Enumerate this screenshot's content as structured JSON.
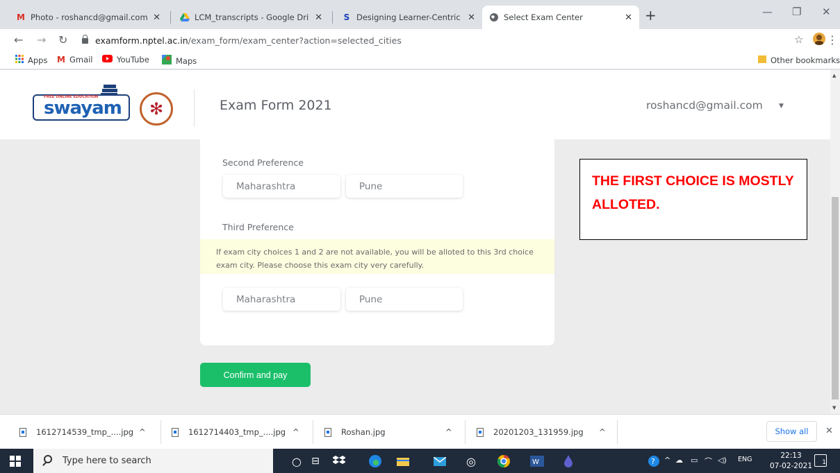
{
  "tabs": [
    {
      "title": "Photo - roshancd@gmail.com - G",
      "icon": "M"
    },
    {
      "title": "LCM_transcripts - Google Drive",
      "icon": "drive"
    },
    {
      "title": "Designing Learner-Centric MOOC",
      "icon": "S"
    },
    {
      "title": "Select Exam Center",
      "icon": "globe"
    }
  ],
  "toolbar": {
    "url_host": "examform.nptel.ac.in",
    "url_path": "/exam_form/exam_center?action=selected_cities"
  },
  "bookmarks": {
    "items": [
      "Apps",
      "Gmail",
      "YouTube",
      "Maps"
    ],
    "other": "Other bookmarks"
  },
  "header": {
    "logo_text": "swayam",
    "logo_small": "FREE ONLINE EDUCATION",
    "title": "Exam Form 2021",
    "user_email": "roshancd@gmail.com"
  },
  "form": {
    "second_pref_label": "Second Preference",
    "second_state": "Maharashtra",
    "second_city": "Pune",
    "third_pref_label": "Third Preference",
    "warning": "If exam city choices 1 and 2 are not available, you will be alloted to this 3rd choice exam city. Please choose this exam city very carefully.",
    "third_state": "Maharashtra",
    "third_city": "Pune",
    "confirm_label": "Confirm and pay"
  },
  "annotation": {
    "text": "THE FIRST CHOICE IS MOSTLY ALLOTED."
  },
  "downloads": {
    "items": [
      "1612714539_tmp_....jpg",
      "1612714403_tmp_....jpg",
      "Roshan.jpg",
      "20201203_131959.jpg"
    ],
    "show_all": "Show all"
  },
  "taskbar": {
    "search_placeholder": "Type here to search",
    "lang": "ENG",
    "time": "22:13",
    "date": "07-02-2021",
    "notifications": "1"
  },
  "colors": {
    "confirm_green": "#1bbf6a",
    "annotation_red": "#ff0000",
    "warning_bg": "#fdfde0"
  }
}
